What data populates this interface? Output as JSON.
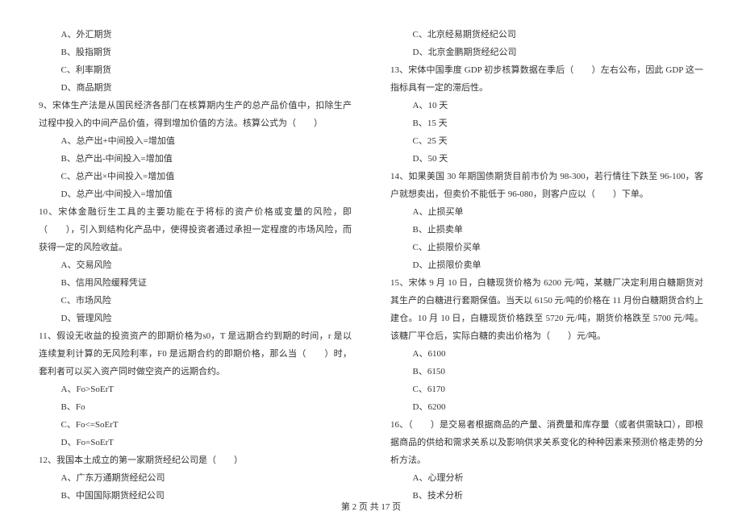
{
  "left": {
    "q8_opts": [
      "A、外汇期货",
      "B、股指期货",
      "C、利率期货",
      "D、商品期货"
    ],
    "q9_stem": "9、宋体生产法是从国民经济各部门在核算期内生产的总产品价值中，扣除生产过程中投入的中间产品价值，得到增加价值的方法。核算公式为（　　）",
    "q9_opts": [
      "A、总产出+中间投入=增加值",
      "B、总产出-中间投入=增加值",
      "C、总产出×中间投入=增加值",
      "D、总产出/中间投入=增加值"
    ],
    "q10_stem": "10、宋体金融衍生工具的主要功能在于将标的资产价格或变量的风险，即（　　），引入到结构化产品中，使得投资者通过承担一定程度的市场风险，而获得一定的风险收益。",
    "q10_opts": [
      "A、交易风险",
      "B、信用风险缓释凭证",
      "C、市场风险",
      "D、管理风险"
    ],
    "q11_stem": "11、假设无收益的投资资产的即期价格为s0，T 是远期合约到期的时间，r 是以连续复利计算的无风险利率，F0 是远期合约的即期价格，那么当（　　）时，套利者可以买入资产同时做空资产的远期合约。",
    "q11_opts": [
      "A、Fo>SoErT",
      "B、Fo",
      "C、Fo<=SoErT",
      "D、Fo=SoErT"
    ],
    "q12_stem": "12、我国本土成立的第一家期货经纪公司是（　　）",
    "q12_opts_partial": [
      "A、广东万通期货经纪公司",
      "B、中国国际期货经纪公司"
    ]
  },
  "right": {
    "q12_opts_cont": [
      "C、北京经易期货经纪公司",
      "D、北京金鹏期货经纪公司"
    ],
    "q13_stem": "13、宋体中国季度 GDP 初步核算数据在季后（　　）左右公布，因此 GDP 这一指标具有一定的滞后性。",
    "q13_opts": [
      "A、10 天",
      "B、15 天",
      "C、25 天",
      "D、50 天"
    ],
    "q14_stem": "14、如果美国 30 年期国债期货目前市价为 98-300，若行情往下跌至 96-100，客户就想卖出，但卖价不能低于 96-080，则客户应以（　　）下单。",
    "q14_opts": [
      "A、止损买单",
      "B、止损卖单",
      "C、止损限价买单",
      "D、止损限价卖单"
    ],
    "q15_stem": "15、宋体 9 月 10 日，白糖现货价格为 6200 元/吨，某糖厂决定利用白糖期货对其生产的白糖进行套期保值。当天以 6150 元/吨的价格在 11 月份白糖期货合约上建仓。10 月 10 日，白糖现货价格跌至 5720 元/吨，期货价格跌至 5700 元/吨。该糖厂平仓后，实际白糖的卖出价格为（　　）元/吨。",
    "q15_opts": [
      "A、6100",
      "B、6150",
      "C、6170",
      "D、6200"
    ],
    "q16_stem": "16、（　　）是交易者根据商品的产量、消费量和库存量（或者供需缺口），即根据商品的供给和需求关系以及影响供求关系变化的种种因素来预测价格走势的分析方法。",
    "q16_opts_partial": [
      "A、心理分析",
      "B、技术分析"
    ]
  },
  "footer": "第 2 页 共 17 页"
}
